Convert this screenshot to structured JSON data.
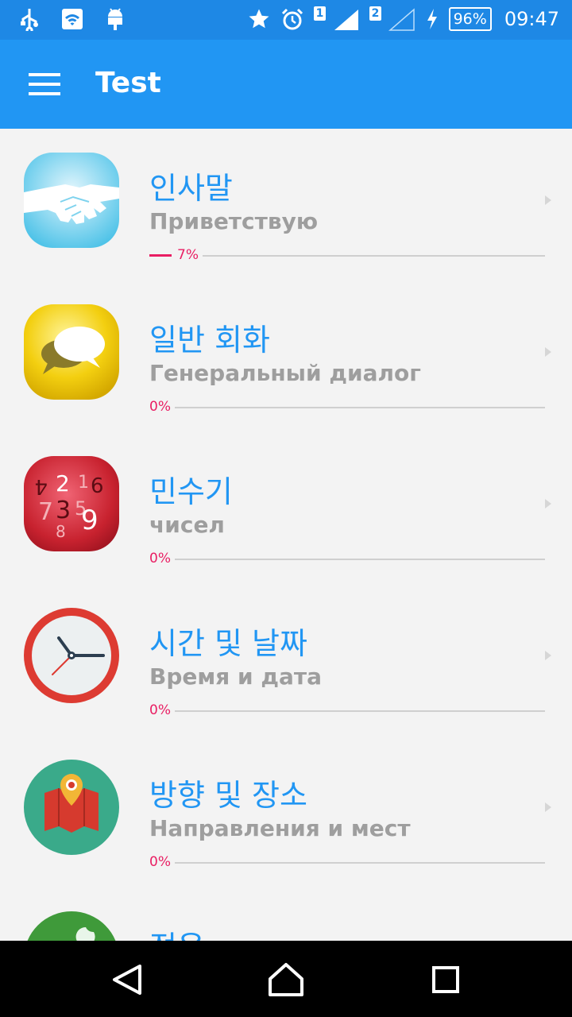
{
  "status_bar": {
    "time": "09:47",
    "battery": "96%",
    "sim1": "1",
    "sim2": "2",
    "icons_left": [
      "usb-icon",
      "wifi-icon",
      "android-icon"
    ],
    "icons_right": [
      "star-icon",
      "alarm-icon",
      "signal-icon",
      "charging-icon",
      "battery-icon"
    ]
  },
  "app_bar": {
    "title": "Test",
    "menu_icon": "hamburger-menu-icon"
  },
  "colors": {
    "status_bar": "#1e88e5",
    "app_bar": "#2196f3",
    "title_korean": "#2196f3",
    "progress": "#e91e63",
    "subtitle": "#9e9e9e"
  },
  "lessons": [
    {
      "title": "인사말",
      "subtitle": "Приветствую",
      "progress_label": "7%",
      "progress": 0.07,
      "icon": "handshake-icon"
    },
    {
      "title": "일반 회화",
      "subtitle": "Генеральный диалог",
      "progress_label": "0%",
      "progress": 0,
      "icon": "chat-bubbles-icon"
    },
    {
      "title": "민수기",
      "subtitle": "чисел",
      "progress_label": "0%",
      "progress": 0,
      "icon": "numbers-icon"
    },
    {
      "title": "시간 및 날짜",
      "subtitle": "Время и дата",
      "progress_label": "0%",
      "progress": 0,
      "icon": "clock-icon"
    },
    {
      "title": "방향 및 장소",
      "subtitle": "Направления и мест",
      "progress_label": "0%",
      "progress": 0,
      "icon": "map-pin-icon"
    },
    {
      "title": "정윤",
      "subtitle": "",
      "progress_label": "",
      "progress": 0,
      "icon": "moon-icon"
    }
  ],
  "nav_bar": {
    "buttons": [
      "back-icon",
      "home-icon",
      "recents-icon"
    ]
  }
}
